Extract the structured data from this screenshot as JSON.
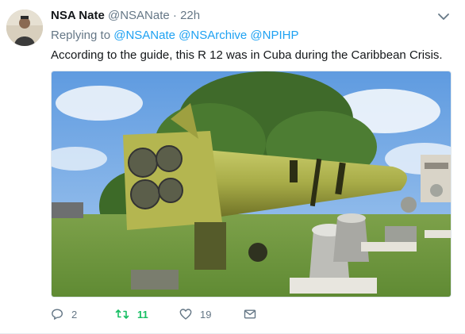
{
  "tweet": {
    "author_name": "NSA Nate",
    "author_handle": "@NSANate",
    "separator": "·",
    "time": "22h",
    "replying_prefix": "Replying to",
    "replying_to": [
      "@NSANate",
      "@NSArchive",
      "@NPIHP"
    ],
    "text": "According to the guide, this R 12 was in Cuba during the Caribbean Crisis.",
    "media_icon": "photo",
    "actions": {
      "reply_count": "2",
      "retweet_count": "11",
      "like_count": "19"
    },
    "icons": {
      "caret": "chevron-down-icon",
      "reply": "reply-icon",
      "retweet": "retweet-icon",
      "like": "heart-icon",
      "message": "envelope-icon"
    },
    "colors": {
      "link": "#1da1f2",
      "retweet_active": "#17bf63",
      "secondary_text": "#657786"
    }
  }
}
